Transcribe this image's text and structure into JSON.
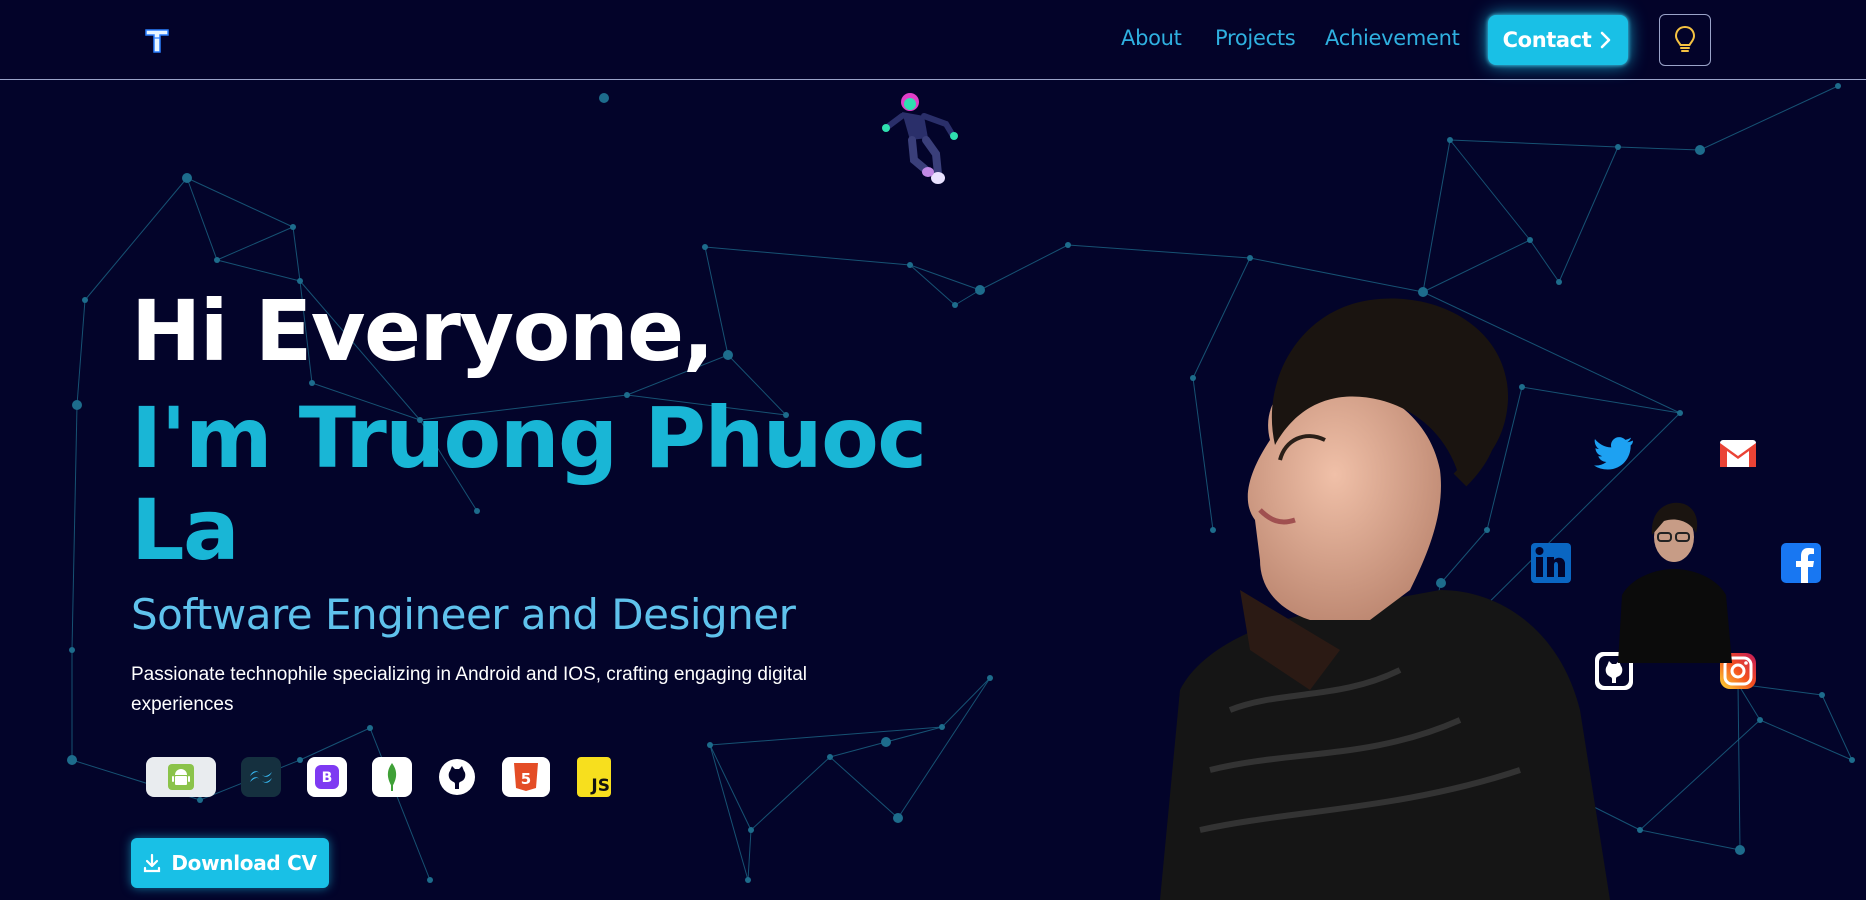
{
  "nav": {
    "logo_letter": "T",
    "links": [
      "About",
      "Projects",
      "Achievement"
    ],
    "contact_label": "Contact",
    "icons": {
      "contact": "chevron-right-icon",
      "theme": "lightbulb-icon"
    }
  },
  "hero": {
    "greeting": "Hi Everyone,",
    "name": "I'm Truong Phuoc La",
    "role": "Software Engineer and Designer",
    "description": "Passionate technophile specializing in Android and IOS, crafting engaging digital experiences",
    "download_label": "Download CV",
    "download_icon": "download-icon"
  },
  "tech_stack": [
    {
      "name": "android-icon"
    },
    {
      "name": "tailwind-icon"
    },
    {
      "name": "bootstrap-icon",
      "glyph": "B"
    },
    {
      "name": "mongodb-icon"
    },
    {
      "name": "github-icon"
    },
    {
      "name": "html5-icon",
      "glyph": "5"
    },
    {
      "name": "javascript-icon",
      "glyph": "JS"
    }
  ],
  "social": [
    "twitter-icon",
    "gmail-icon",
    "linkedin-icon",
    "facebook-icon",
    "github-icon",
    "instagram-icon"
  ],
  "colors": {
    "background": "#03042a",
    "accent": "#19c0e6",
    "nav_link": "#2fb0e0",
    "name": "#19b6d6",
    "role": "#5fc2ec",
    "network": "#1d6c8c"
  }
}
